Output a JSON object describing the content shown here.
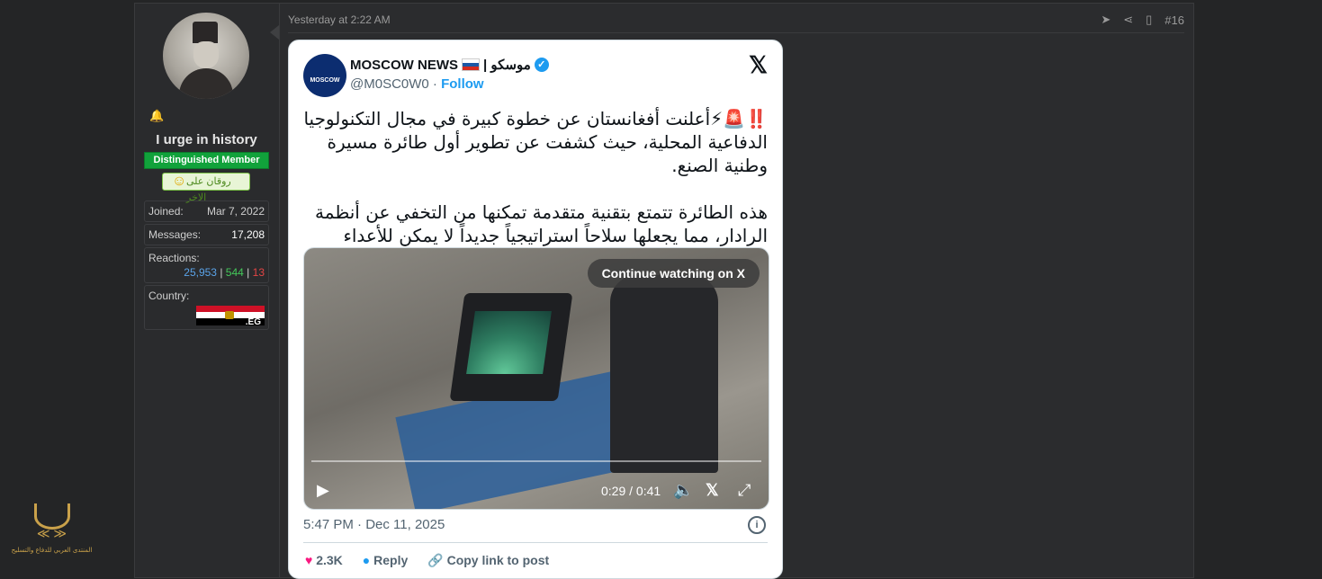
{
  "user": {
    "name": "I urge in history",
    "title": "Distinguished Member",
    "banner": "روقان على الاخر",
    "joined_label": "Joined:",
    "joined": "Mar 7, 2022",
    "messages_label": "Messages:",
    "messages": "17,208",
    "reactions_label": "Reactions:",
    "reactions_like": "25,953",
    "reactions_sep": "|",
    "reactions_positive": "544",
    "reactions_negative": "13",
    "country_label": "Country:",
    "country_code": ".EG"
  },
  "post": {
    "time": "Yesterday at 2:22 AM",
    "number": "#16"
  },
  "tweet": {
    "avatar_label": "MOSCOW",
    "author_name": "MOSCOW NEWS",
    "author_suffix": "| موسكو",
    "handle": "@M0SC0W0",
    "dot": "·",
    "follow": "Follow",
    "para1": "‼️🚨⚡أعلنت أفغانستان عن خطوة كبيرة في مجال التكنولوجيا الدفاعية المحلية، حيث كشفت عن تطوير أول طائرة مسيرة وطنية الصنع.",
    "para2": "هذه الطائرة تتمتع بتقنية متقدمة تمكنها من التخفي عن أنظمة الرادار، مما يجعلها سلاحاً استراتيجياً جديداً لا يمكن للأعداء رصده.",
    "continue": "Continue watching on X",
    "timecode": "0:29 / 0:41",
    "posted": "5:47 PM · Dec 11, 2025",
    "likes": "2.3K",
    "reply": "Reply",
    "copy_link": "Copy link to post"
  },
  "site_logo_text": "المنتدى العربي للدفاع والتسليح"
}
